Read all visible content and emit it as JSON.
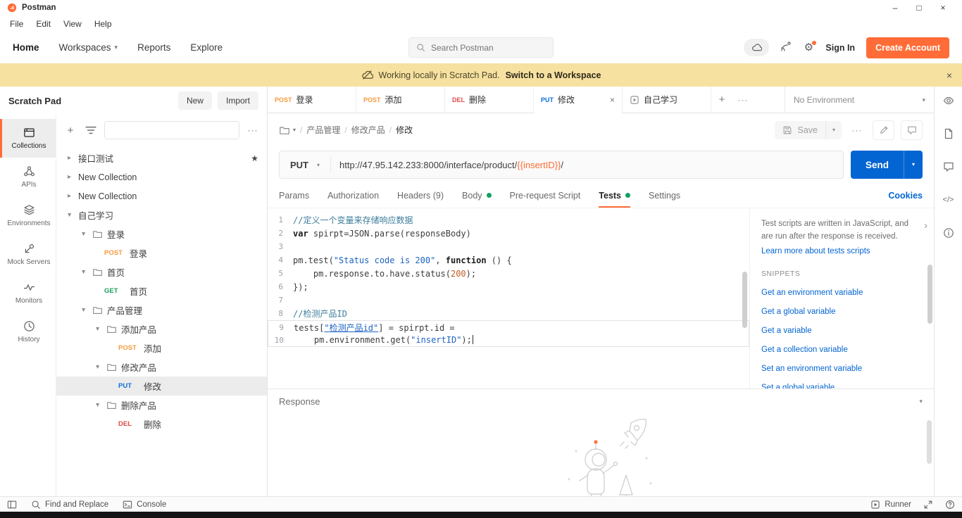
{
  "colors": {
    "accent": "#ff6c37",
    "blue": "#0265d2",
    "link": "#0265d2",
    "banner": "#f6e1a1",
    "dot": "#10a35f",
    "comment": "#3d7e9a",
    "string": "#1d63c1",
    "number": "#c05e1f",
    "methods": {
      "GET": "#1ba05f",
      "POST": "#f79a3e",
      "PUT": "#0f6fdc",
      "DEL": "#df4b4a"
    }
  },
  "icons": {
    "chevron-right": "▸",
    "chevron-down": "▾",
    "star": "★",
    "close": "×",
    "more-h": "···",
    "plus": "+",
    "gear": "⚙",
    "code": "</>",
    "minimize": "–",
    "maximize": "□",
    "panel-chevron": "›"
  },
  "titlebar": {
    "app": "Postman"
  },
  "menubar": {
    "items": [
      "File",
      "Edit",
      "View",
      "Help"
    ]
  },
  "navbar": {
    "items": [
      {
        "label": "Home"
      },
      {
        "label": "Workspaces",
        "chevron": true
      },
      {
        "label": "Reports"
      },
      {
        "label": "Explore"
      }
    ],
    "search_placeholder": "Search Postman",
    "sign_in": "Sign In",
    "create_account": "Create Account"
  },
  "banner": {
    "text": "Working locally in Scratch Pad.",
    "link": "Switch to a Workspace"
  },
  "sidebar": {
    "title": "Scratch Pad",
    "new": "New",
    "import": "Import",
    "filter_placeholder": "",
    "rail": [
      {
        "icon": "collections",
        "label": "Collections",
        "selected": true
      },
      {
        "icon": "apis",
        "label": "APIs"
      },
      {
        "icon": "environments",
        "label": "Environments"
      },
      {
        "icon": "mock",
        "label": "Mock Servers"
      },
      {
        "icon": "monitors",
        "label": "Monitors"
      },
      {
        "icon": "history",
        "label": "History"
      }
    ],
    "tree": [
      {
        "type": "collection",
        "label": "接口测试",
        "expanded": false,
        "depth": 0,
        "starred": true
      },
      {
        "type": "collection",
        "label": "New Collection",
        "expanded": false,
        "depth": 0
      },
      {
        "type": "collection",
        "label": "New Collection",
        "expanded": false,
        "depth": 0
      },
      {
        "type": "collection",
        "label": "自己学习",
        "expanded": true,
        "depth": 0
      },
      {
        "type": "folder",
        "label": "登录",
        "expanded": true,
        "depth": 1
      },
      {
        "type": "request",
        "method": "POST",
        "label": "登录",
        "depth": 2
      },
      {
        "type": "folder",
        "label": "首页",
        "expanded": true,
        "depth": 1
      },
      {
        "type": "request",
        "method": "GET",
        "label": "首页",
        "depth": 2
      },
      {
        "type": "folder",
        "label": "产品管理",
        "expanded": true,
        "depth": 1
      },
      {
        "type": "folder",
        "label": "添加产品",
        "expanded": true,
        "depth": 2
      },
      {
        "type": "request",
        "method": "POST",
        "label": "添加",
        "depth": 3
      },
      {
        "type": "folder",
        "label": "修改产品",
        "expanded": true,
        "depth": 2
      },
      {
        "type": "request",
        "method": "PUT",
        "label": "修改",
        "depth": 3,
        "selected": true
      },
      {
        "type": "folder",
        "label": "删除产品",
        "expanded": true,
        "depth": 2
      },
      {
        "type": "request",
        "method": "DEL",
        "label": "删除",
        "depth": 3
      }
    ]
  },
  "tabs": {
    "items": [
      {
        "method": "POST",
        "label": "登录"
      },
      {
        "method": "POST",
        "label": "添加"
      },
      {
        "method": "DEL",
        "label": "删除"
      },
      {
        "method": "PUT",
        "label": "修改",
        "active": true
      },
      {
        "icon": "runner",
        "label": "自己学习"
      }
    ],
    "environment": "No Environment"
  },
  "request": {
    "breadcrumb": [
      "产品管理",
      "修改产品",
      "修改"
    ],
    "save": "Save",
    "method": "PUT",
    "url_parts": [
      {
        "t": "plain",
        "s": "http://47.95.142.233:8000/interface/product/"
      },
      {
        "t": "var",
        "s": "{{insertID}}"
      },
      {
        "t": "plain",
        "s": "/"
      }
    ],
    "send": "Send",
    "tabs": [
      {
        "label": "Params"
      },
      {
        "label": "Authorization"
      },
      {
        "label": "Headers",
        "suffix": " (9)"
      },
      {
        "label": "Body",
        "dot": true
      },
      {
        "label": "Pre-request Script"
      },
      {
        "label": "Tests",
        "dot": true,
        "active": true
      },
      {
        "label": "Settings"
      }
    ],
    "cookies": "Cookies"
  },
  "editor": {
    "lines": [
      {
        "tokens": [
          {
            "t": "comment",
            "s": "//定义一个变量来存储响应数据"
          }
        ]
      },
      {
        "tokens": [
          {
            "t": "keyword",
            "s": "var"
          },
          {
            "t": "plain",
            "s": " spirpt=JSON.parse(responseBody)"
          }
        ]
      },
      {
        "tokens": []
      },
      {
        "tokens": [
          {
            "t": "plain",
            "s": "pm.test("
          },
          {
            "t": "string",
            "s": "\"Status code is 200\""
          },
          {
            "t": "plain",
            "s": ", "
          },
          {
            "t": "keyword",
            "s": "function"
          },
          {
            "t": "plain",
            "s": " () {"
          }
        ]
      },
      {
        "tokens": [
          {
            "t": "plain",
            "s": "    pm.response.to.have.status("
          },
          {
            "t": "number",
            "s": "200"
          },
          {
            "t": "plain",
            "s": ");"
          }
        ]
      },
      {
        "tokens": [
          {
            "t": "plain",
            "s": "});"
          }
        ]
      },
      {
        "tokens": []
      },
      {
        "tokens": [
          {
            "t": "comment",
            "s": "//检测产品ID"
          }
        ]
      },
      {
        "tokens": [
          {
            "t": "plain",
            "s": "tests["
          },
          {
            "t": "string-u",
            "s": "\"检测产品id\""
          },
          {
            "t": "plain",
            "s": "] = spirpt.id ="
          }
        ],
        "box": "top"
      },
      {
        "tokens": [
          {
            "t": "plain",
            "s": "    pm.environment.get("
          },
          {
            "t": "string",
            "s": "\"insertID\""
          },
          {
            "t": "plain",
            "s": ");"
          }
        ],
        "box": "bottom",
        "caret": true
      }
    ]
  },
  "snippets": {
    "help": "Test scripts are written in JavaScript, and are run after the response is received.",
    "learn_more": "Learn more about tests scripts",
    "heading": "SNIPPETS",
    "items": [
      "Get an environment variable",
      "Get a global variable",
      "Get a variable",
      "Get a collection variable",
      "Set an environment variable",
      "Set a global variable"
    ]
  },
  "response": {
    "title": "Response"
  },
  "right_strip": [
    {
      "icon": "eye",
      "name": "environment-quick-look"
    },
    {
      "icon": "doc",
      "name": "documentation"
    },
    {
      "icon": "comment",
      "name": "comments"
    },
    {
      "icon": "code",
      "name": "code-snippet"
    },
    {
      "icon": "info",
      "name": "request-info"
    }
  ],
  "statusbar": {
    "left": [
      {
        "icon": "layout",
        "name": "toggle-sidebar"
      },
      {
        "icon": "search",
        "label": "Find and Replace",
        "name": "find-and-replace"
      },
      {
        "icon": "console",
        "label": "Console",
        "name": "console"
      }
    ],
    "right": [
      {
        "icon": "runner",
        "label": "Runner",
        "name": "runner"
      },
      {
        "icon": "expand",
        "name": "expand-editor"
      },
      {
        "icon": "help",
        "name": "help"
      }
    ]
  }
}
